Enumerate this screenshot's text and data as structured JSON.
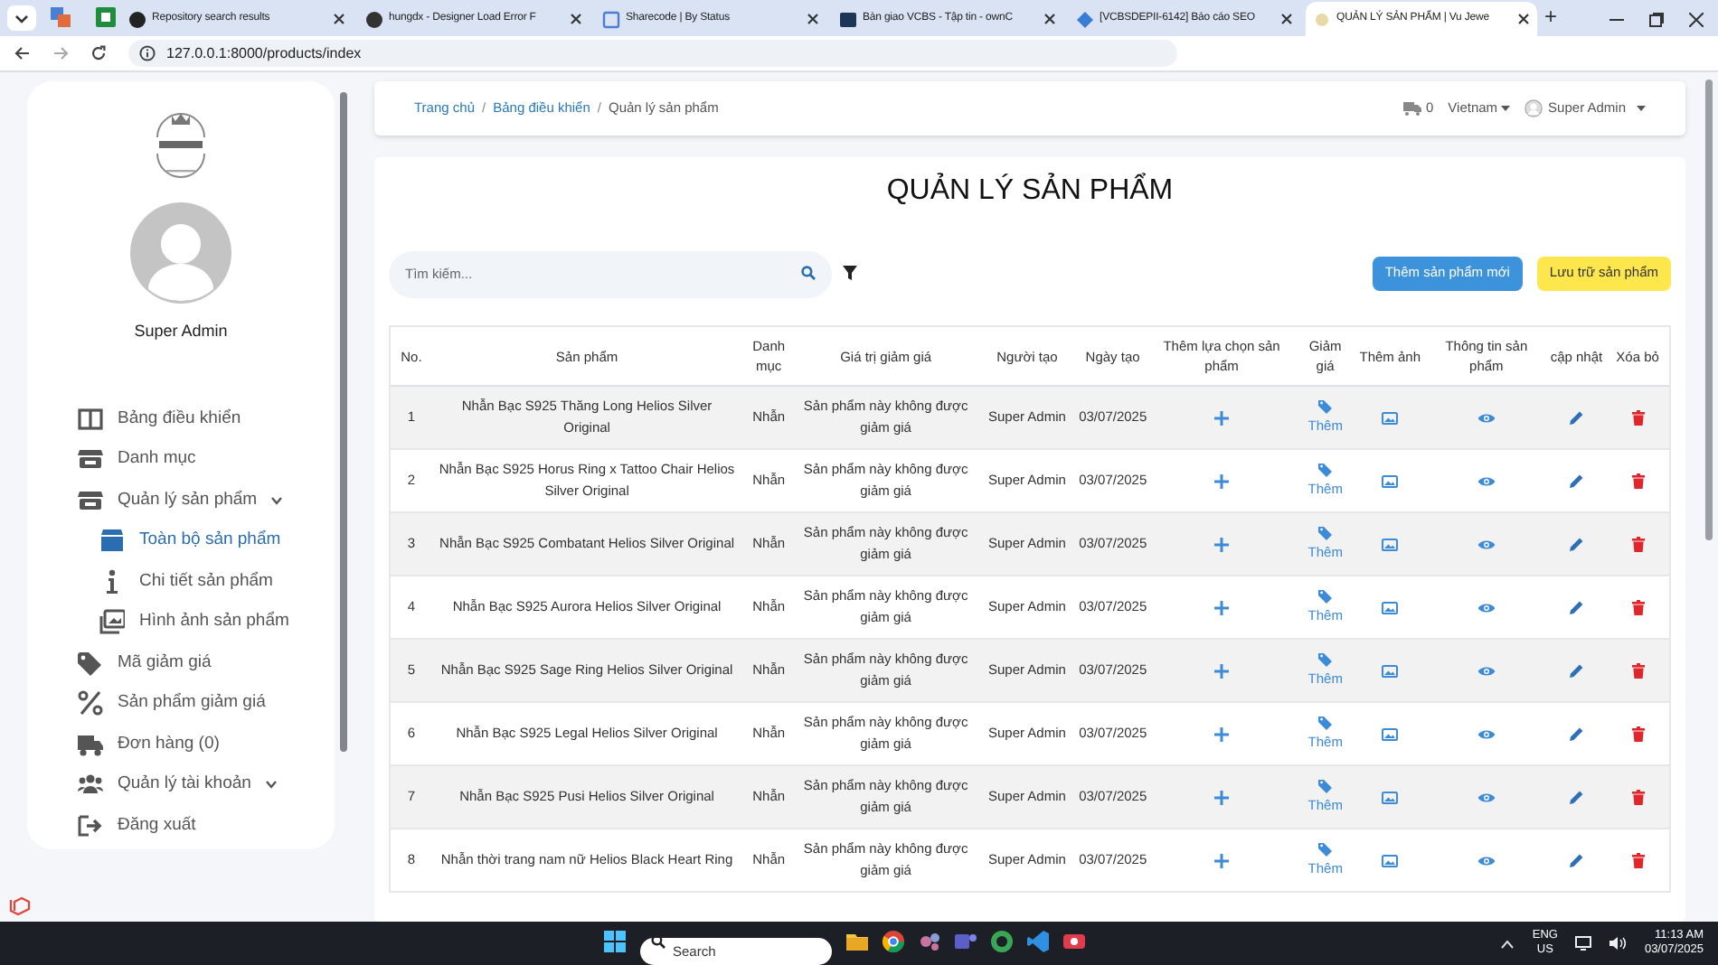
{
  "browser": {
    "tabs": [
      {
        "title": "Repository search results",
        "selected": false
      },
      {
        "title": "hungdx - Designer Load Error F",
        "selected": false
      },
      {
        "title": "Sharecode | By Status",
        "selected": false
      },
      {
        "title": "Bàn giao VCBS - Tập tin - ownC",
        "selected": false
      },
      {
        "title": "[VCBSDEPII-6142] Báo cáo SEO",
        "selected": false
      },
      {
        "title": "QUẢN LÝ SẢN PHẨM | Vu Jewe",
        "selected": true
      }
    ],
    "new_tab": "+",
    "url": "127.0.0.1:8000/products/index"
  },
  "sidebar": {
    "user": "Super Admin",
    "items": [
      {
        "label": "Bảng điều khiển",
        "selected": false
      },
      {
        "label": "Danh mục",
        "selected": false
      },
      {
        "label": "Quản lý sản phẩm",
        "selected": false,
        "expanded": true,
        "children": [
          {
            "label": "Toàn bộ sản phẩm",
            "selected": true
          },
          {
            "label": "Chi tiết sản phẩm",
            "selected": false
          },
          {
            "label": "Hình ảnh sản phẩm",
            "selected": false
          }
        ]
      },
      {
        "label": "Mã giảm giá",
        "selected": false
      },
      {
        "label": "Sản phẩm giảm giá",
        "selected": false
      },
      {
        "label": "Đơn hàng (0)",
        "selected": false
      },
      {
        "label": "Quản lý tài khoản",
        "selected": false,
        "expanded": false
      },
      {
        "label": "Đăng xuất",
        "selected": false
      }
    ]
  },
  "header": {
    "breadcrumb": [
      {
        "kind": "link",
        "text": "Trang chủ"
      },
      {
        "kind": "separator",
        "text": "/"
      },
      {
        "kind": "link",
        "text": "Bảng điều khiển"
      },
      {
        "kind": "separator",
        "text": "/"
      },
      {
        "kind": "current",
        "text": "Quản lý sản phẩm"
      }
    ],
    "cart_count": "0",
    "language": "Vietnam",
    "user": "Super Admin"
  },
  "page": {
    "title": "QUẢN LÝ SẢN PHẨM",
    "search": {
      "placeholder": "Tìm kiếm..."
    },
    "buttons": [
      "Thêm sản phẩm mới",
      "Lưu trữ sản phẩm"
    ]
  },
  "table": {
    "columns": [
      "No.",
      "Sản phẩm",
      "Danh mục",
      "Giá trị giảm giá",
      "Người tạo",
      "Ngày tạo",
      "Thêm lựa chọn sản phẩm",
      "Giảm giá",
      "Thêm ảnh",
      "Thông tin sản phẩm",
      "cập nhật",
      "Xóa bỏ"
    ],
    "rows": [
      {
        "no": "1",
        "product": "Nhẫn Bạc S925 Thăng Long Helios Silver Original",
        "category": "Nhẫn",
        "discount": "Sản phẩm này không được giảm giá",
        "creator": "Super Admin",
        "date": "03/07/2025",
        "discount_link": "Thêm"
      },
      {
        "no": "2",
        "product": "Nhẫn Bạc S925 Horus Ring x Tattoo Chair Helios Silver Original",
        "category": "Nhẫn",
        "discount": "Sản phẩm này không được giảm giá",
        "creator": "Super Admin",
        "date": "03/07/2025",
        "discount_link": "Thêm"
      },
      {
        "no": "3",
        "product": "Nhẫn Bạc S925 Combatant Helios Silver Original",
        "category": "Nhẫn",
        "discount": "Sản phẩm này không được giảm giá",
        "creator": "Super Admin",
        "date": "03/07/2025",
        "discount_link": "Thêm"
      },
      {
        "no": "4",
        "product": "Nhẫn Bạc S925 Aurora Helios Silver Original",
        "category": "Nhẫn",
        "discount": "Sản phẩm này không được giảm giá",
        "creator": "Super Admin",
        "date": "03/07/2025",
        "discount_link": "Thêm"
      },
      {
        "no": "5",
        "product": "Nhẫn Bạc S925 Sage Ring Helios Silver Original",
        "category": "Nhẫn",
        "discount": "Sản phẩm này không được giảm giá",
        "creator": "Super Admin",
        "date": "03/07/2025",
        "discount_link": "Thêm"
      },
      {
        "no": "6",
        "product": "Nhẫn Bạc S925 Legal Helios Silver Original",
        "category": "Nhẫn",
        "discount": "Sản phẩm này không được giảm giá",
        "creator": "Super Admin",
        "date": "03/07/2025",
        "discount_link": "Thêm"
      },
      {
        "no": "7",
        "product": "Nhẫn Bạc S925 Pusi Helios Silver Original",
        "category": "Nhẫn",
        "discount": "Sản phẩm này không được giảm giá",
        "creator": "Super Admin",
        "date": "03/07/2025",
        "discount_link": "Thêm"
      },
      {
        "no": "8",
        "product": "Nhẫn thời trang nam nữ Helios Black Heart Ring",
        "category": "Nhẫn",
        "discount": "Sản phẩm này không được giảm giá",
        "creator": "Super Admin",
        "date": "03/07/2025",
        "discount_link": "Thêm"
      }
    ]
  },
  "taskbar": {
    "search": {
      "placeholder": "Search"
    },
    "language": "ENG",
    "region": "US",
    "time": "11:13 AM",
    "date": "03/07/2025"
  }
}
